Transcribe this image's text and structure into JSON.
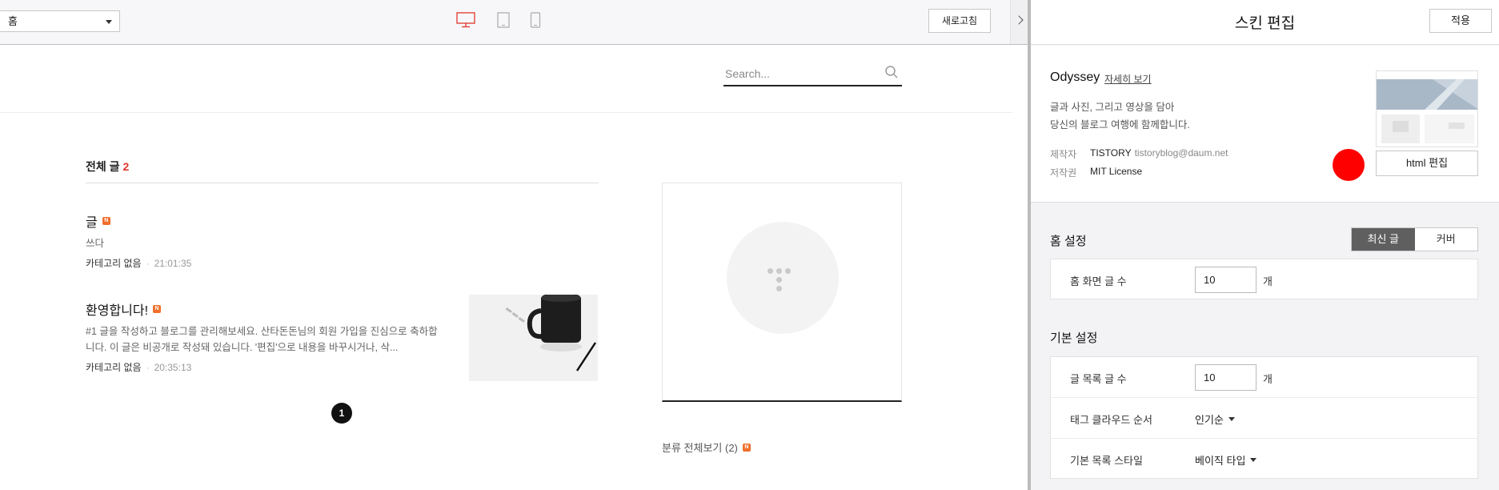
{
  "toolbar": {
    "page_select_value": "홈",
    "refresh_label": "새로고침",
    "accent_color": "#e0362c"
  },
  "search": {
    "placeholder": "Search..."
  },
  "post_list": {
    "title": "전체 글",
    "count": "2",
    "posts": [
      {
        "title": "글",
        "excerpt": "쓰다",
        "category": "카테고리 없음",
        "time": "21:01:35",
        "is_new": true
      },
      {
        "title": "환영합니다!",
        "excerpt": "#1 글을 작성하고 블로그를 관리해보세요. 산타돈돈님의 회원 가입을 진심으로 축하합니다. 이 글은 비공개로 작성돼 있습니다. '편집'으로 내용을 바꾸시거나, 삭...",
        "category": "카테고리 없음",
        "time": "20:35:13",
        "is_new": true
      }
    ],
    "current_page": "1",
    "meta_separator": "·"
  },
  "sidebar": {
    "category_link": "분류 전체보기 (2)",
    "new_badge": "N"
  },
  "skin_editor": {
    "title": "스킨 편집",
    "apply_label": "적용",
    "skin_name": "Odyssey",
    "more_link": "자세히 보기",
    "desc_line1": "글과 사진, 그리고 영상을 담아",
    "desc_line2": "당신의 블로그 여행에 함께합니다.",
    "author_label": "제작자",
    "author_value": "TISTORY",
    "author_email": "tistoryblog@daum.net",
    "license_label": "저작권",
    "license_value": "MIT License",
    "html_edit_label": "html 편집",
    "home_settings": {
      "title": "홈 설정",
      "options": [
        "최신 글",
        "커버"
      ],
      "selected": "최신 글",
      "rows": [
        {
          "label": "홈 화면 글 수",
          "value": "10",
          "unit": "개"
        }
      ]
    },
    "basic_settings": {
      "title": "기본 설정",
      "post_count": {
        "label": "글 목록 글 수",
        "value": "10",
        "unit": "개"
      },
      "tag_order": {
        "label": "태그 클라우드 순서",
        "value": "인기순"
      },
      "list_style": {
        "label": "기본 목록 스타일",
        "value": "베이직 타입"
      }
    }
  }
}
